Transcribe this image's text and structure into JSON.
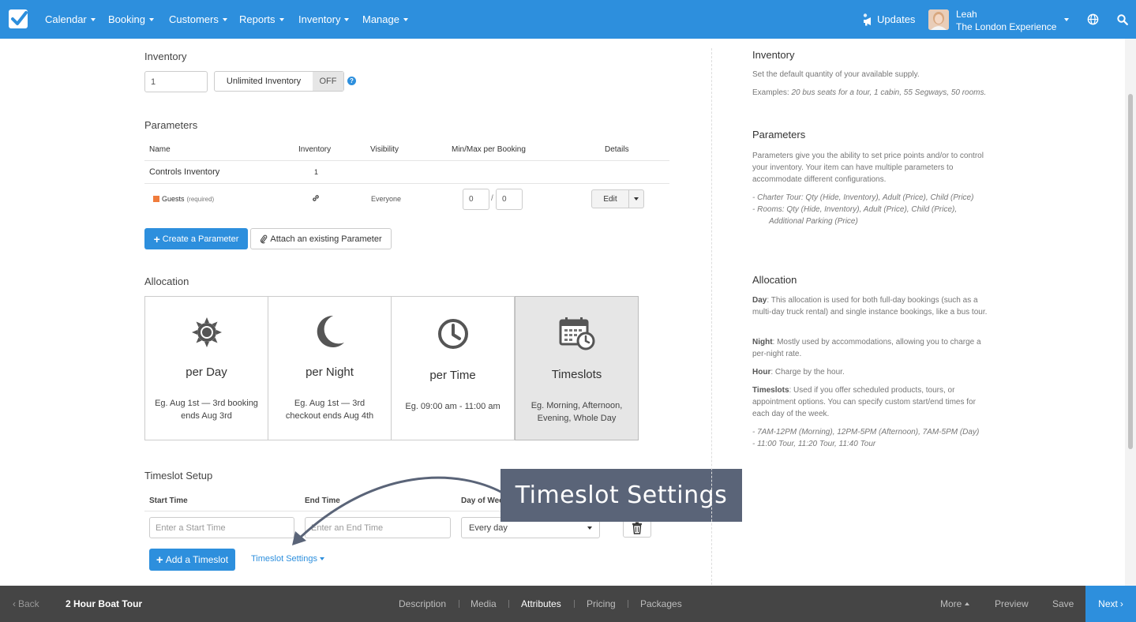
{
  "nav": {
    "items": [
      {
        "label": "Calendar"
      },
      {
        "label": "Booking"
      },
      {
        "label": "Customers"
      },
      {
        "label": "Reports"
      },
      {
        "label": "Inventory"
      },
      {
        "label": "Manage"
      }
    ],
    "updates_label": "Updates",
    "user_name": "Leah",
    "company_name": "The London Experience"
  },
  "inventory": {
    "title": "Inventory",
    "quantity_value": "1",
    "unlimited_label": "Unlimited Inventory",
    "unlimited_state": "OFF"
  },
  "parameters": {
    "title": "Parameters",
    "columns": [
      "Name",
      "Inventory",
      "Visibility",
      "Min/Max per Booking",
      "Details"
    ],
    "group_row": {
      "name": "Controls Inventory",
      "inventory": "1"
    },
    "rows": [
      {
        "name": "Guests",
        "required": "(required)",
        "visibility": "Everyone",
        "min": "0",
        "max": "0",
        "edit_label": "Edit",
        "color": "#f07c3c"
      }
    ],
    "create_label": "Create a Parameter",
    "attach_label": "Attach an existing Parameter"
  },
  "allocation": {
    "title": "Allocation",
    "options": [
      {
        "label": "per Day",
        "desc_line1": "Eg. Aug 1st — 3rd booking",
        "desc_line2": "ends Aug 3rd",
        "icon": "sun-icon",
        "selected": false
      },
      {
        "label": "per Night",
        "desc_line1": "Eg. Aug 1st — 3rd",
        "desc_line2": "checkout ends Aug 4th",
        "icon": "moon-icon",
        "selected": false
      },
      {
        "label": "per Time",
        "desc_line1": "Eg. 09:00 am - 11:00 am",
        "desc_line2": "",
        "icon": "clock-icon",
        "selected": false
      },
      {
        "label": "Timeslots",
        "desc_line1": "Eg. Morning, Afternoon,",
        "desc_line2": "Evening, Whole Day",
        "icon": "calendar-clock-icon",
        "selected": true
      }
    ]
  },
  "timeslot": {
    "title": "Timeslot Setup",
    "columns": [
      "Start Time",
      "End Time",
      "Day of Week"
    ],
    "start_placeholder": "Enter a Start Time",
    "end_placeholder": "Enter an End Time",
    "day_value": "Every day",
    "add_label": "Add a Timeslot",
    "settings_label": "Timeslot Settings"
  },
  "callout": {
    "text": "Timeslot Settings"
  },
  "help": {
    "inventory_title": "Inventory",
    "inventory_text": "Set the default quantity of your available supply.",
    "inventory_examples_prefix": "Examples: ",
    "inventory_examples": "20 bus seats for a tour, 1 cabin, 55 Segways, 50 rooms.",
    "parameters_title": "Parameters",
    "parameters_text": "Parameters give you the ability to set price points and/or to control your inventory. Your item can have multiple parameters to accommodate different configurations.",
    "parameters_ex1": "- Charter Tour: Qty (Hide, Inventory), Adult (Price), Child (Price)",
    "parameters_ex2": "- Rooms: Qty (Hide, Inventory), Adult (Price), Child (Price),",
    "parameters_ex3": "Additional Parking (Price)",
    "allocation_title": "Allocation",
    "day_term": "Day",
    "day_text": ": This allocation is used for both full-day bookings (such as a multi-day truck rental) and single instance bookings, like a bus tour.",
    "night_term": "Night",
    "night_text": ": Mostly used by accommodations, allowing you to charge a per-night rate.",
    "hour_term": "Hour",
    "hour_text": ": Charge by the hour.",
    "timeslots_term": "Timeslots",
    "timeslots_text": ": Used if you offer scheduled products, tours, or appointment options. You can specify custom start/end times for each day of the week.",
    "timeslots_ex1": "- 7AM-12PM (Morning), 12PM-5PM (Afternoon), 7AM-5PM (Day)",
    "timeslots_ex2": "- 11:00 Tour, 11:20 Tour, 11:40 Tour"
  },
  "bottom": {
    "back_label": "Back",
    "product_name": "2 Hour Boat Tour",
    "tabs": [
      "Description",
      "Media",
      "Attributes",
      "Pricing",
      "Packages"
    ],
    "active_tab": "Attributes",
    "more_label": "More",
    "preview_label": "Preview",
    "save_label": "Save",
    "next_label": "Next"
  },
  "colors": {
    "brand": "#2d8fdd",
    "callout": "#5a6478",
    "bottom_bar": "#454545"
  }
}
